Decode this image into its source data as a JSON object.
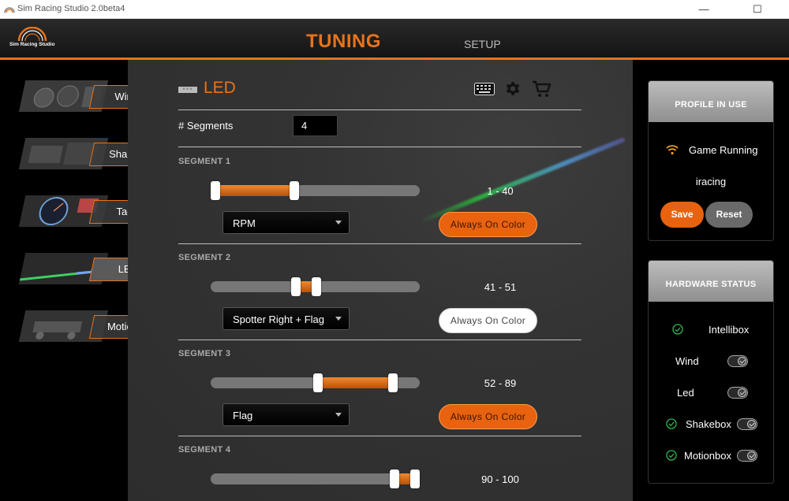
{
  "window": {
    "title": "Sim Racing Studio 2.0beta4",
    "controls": [
      "—",
      "☐",
      "✕"
    ]
  },
  "header": {
    "logo_text": "Sim Racing Studio",
    "tab_tuning": "TUNING",
    "tab_setup": "SETUP",
    "accent": "#e8731a"
  },
  "sidebar": {
    "items": [
      {
        "label": "Wind"
      },
      {
        "label": "Shake"
      },
      {
        "label": "Tach"
      },
      {
        "label": "LED",
        "selected": true
      },
      {
        "label": "Motion"
      }
    ]
  },
  "main": {
    "icon_text": "×××",
    "title": "LED",
    "segments_label": "# Segments",
    "segments_value": "4",
    "segments": [
      {
        "title": "SEGMENT 1",
        "range": "1 - 40",
        "start": 1,
        "end": 40,
        "source": "RPM",
        "color_button": "Always On Color",
        "color_style": "orange"
      },
      {
        "title": "SEGMENT 2",
        "range": "41 - 51",
        "start": 41,
        "end": 51,
        "source": "Spotter Right + Flag",
        "color_button": "Always On Color",
        "color_style": "white"
      },
      {
        "title": "SEGMENT 3",
        "range": "52 - 89",
        "start": 52,
        "end": 89,
        "source": "Flag",
        "color_button": "Always On Color",
        "color_style": "orange"
      },
      {
        "title": "SEGMENT 4",
        "range": "90 - 100",
        "start": 90,
        "end": 100
      }
    ]
  },
  "profile": {
    "header": "PROFILE IN USE",
    "status": "Game Running",
    "game": "iracing",
    "save": "Save",
    "reset": "Reset"
  },
  "hardware": {
    "header": "HARDWARE STATUS",
    "items": [
      {
        "label": "Intellibox",
        "connected": true,
        "toggle": false
      },
      {
        "label": "Wind",
        "connected": false,
        "toggle": true
      },
      {
        "label": "Led",
        "connected": false,
        "toggle": true
      },
      {
        "label": "Shakebox",
        "connected": true,
        "toggle": true
      },
      {
        "label": "Motionbox",
        "connected": true,
        "toggle": true
      }
    ]
  }
}
